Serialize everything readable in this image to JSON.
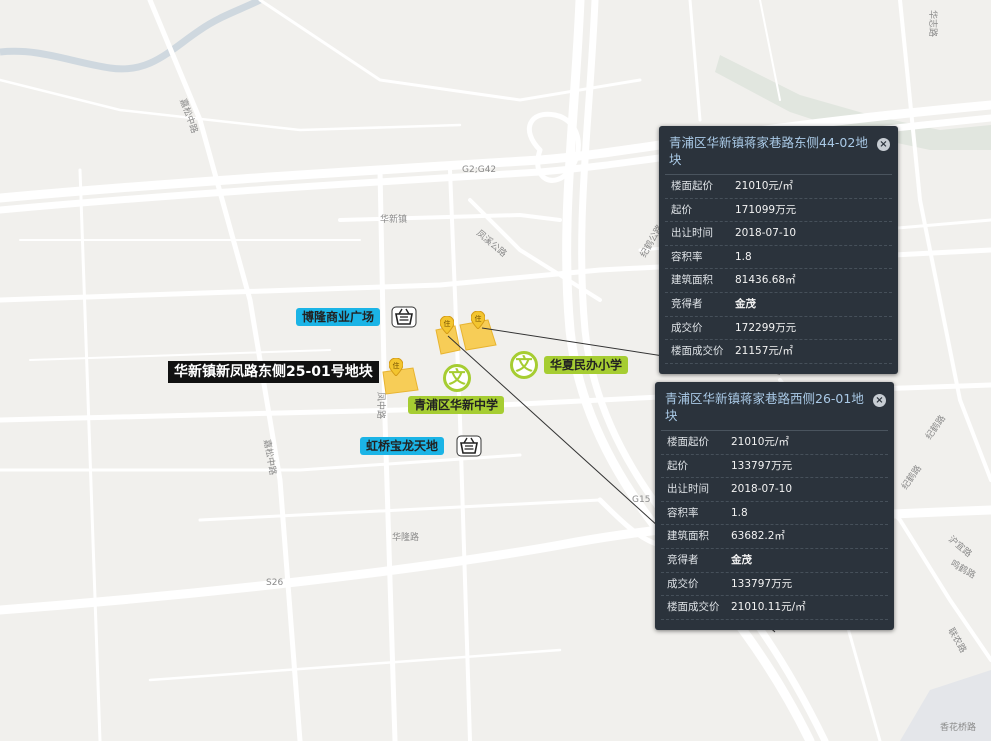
{
  "map": {
    "road_labels": [
      "嘉松中路",
      "G2;G42",
      "华新镇",
      "凤溪公路",
      "纪鹤公路",
      "凤中路",
      "嘉松中路",
      "华隆路",
      "G15",
      "S26",
      "纪鹤路",
      "沪宜路",
      "纪鹤路",
      "鸣鹤路",
      "联农路",
      "华志路",
      "香花桥路"
    ],
    "pois": {
      "bolong": "博隆商业广场",
      "plot2501": "华新镇新凤路东侧25-01号地块",
      "huaxin_middle": "青浦区华新中学",
      "huaxia_primary": "华夏民办小学",
      "hongqiao_longfor": "虹桥宝龙天地"
    },
    "pin_glyph": "住",
    "edu_glyph": "文",
    "colors": {
      "poi_blue": "#1bb4e6",
      "poi_green": "#a6cd32",
      "plot": "#f7cd57",
      "panel": "#2b333c"
    }
  },
  "panels": [
    {
      "title": "青浦区华新镇蒋家巷路东侧44-02地块",
      "rows": [
        {
          "k": "楼面起价",
          "v": "21010元/㎡"
        },
        {
          "k": "起价",
          "v": "171099万元"
        },
        {
          "k": "出让时间",
          "v": "2018-07-10"
        },
        {
          "k": "容积率",
          "v": "1.8"
        },
        {
          "k": "建筑面积",
          "v": "81436.68㎡"
        },
        {
          "k": "竞得者",
          "v": "金茂"
        },
        {
          "k": "成交价",
          "v": "172299万元"
        },
        {
          "k": "楼面成交价",
          "v": "21157元/㎡"
        }
      ]
    },
    {
      "title": "青浦区华新镇蒋家巷路西侧26-01地块",
      "rows": [
        {
          "k": "楼面起价",
          "v": "21010元/㎡"
        },
        {
          "k": "起价",
          "v": "133797万元"
        },
        {
          "k": "出让时间",
          "v": "2018-07-10"
        },
        {
          "k": "容积率",
          "v": "1.8"
        },
        {
          "k": "建筑面积",
          "v": "63682.2㎡"
        },
        {
          "k": "竞得者",
          "v": "金茂"
        },
        {
          "k": "成交价",
          "v": "133797万元"
        },
        {
          "k": "楼面成交价",
          "v": "21010.11元/㎡"
        }
      ]
    }
  ],
  "close_glyph": "×"
}
